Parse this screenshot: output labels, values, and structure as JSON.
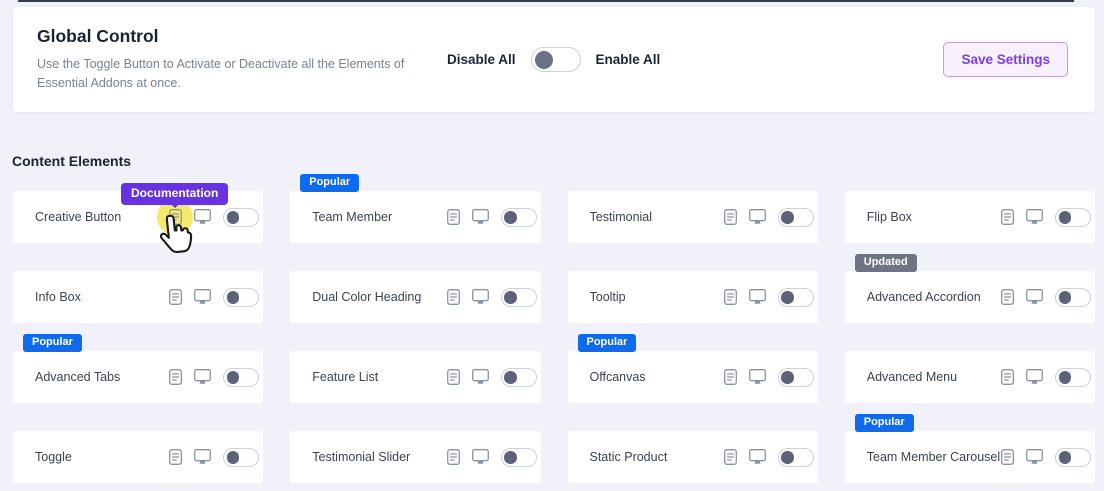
{
  "colors": {
    "page_bg": "#f1f1fa",
    "accent_purple": "#7a3bf0",
    "save_btn_bg": "#f8f0ff",
    "save_btn_border": "#c09bf0",
    "badge_popular": "#0e6bf0",
    "badge_updated": "#6d7585",
    "tooltip_bg": "#6732e3",
    "toggle_knob": "#5c6378",
    "highlight_yellow": "#f3e549",
    "heading_text": "#1b2232",
    "card_text": "#3d4352"
  },
  "global_control": {
    "title": "Global Control",
    "description": "Use the Toggle Button to Activate or Deactivate all the Elements of Essential Addons at once.",
    "disable_all_label": "Disable All",
    "enable_all_label": "Enable All",
    "save_button_label": "Save Settings",
    "master_toggle_state": "off"
  },
  "content_elements": {
    "section_title": "Content Elements",
    "tooltip_label": "Documentation",
    "items": [
      {
        "name": "Creative Button",
        "badge": "",
        "toggle": "off",
        "highlighted": true
      },
      {
        "name": "Team Member",
        "badge": "Popular",
        "toggle": "off"
      },
      {
        "name": "Testimonial",
        "badge": "",
        "toggle": "off"
      },
      {
        "name": "Flip Box",
        "badge": "",
        "toggle": "off"
      },
      {
        "name": "Info Box",
        "badge": "",
        "toggle": "off"
      },
      {
        "name": "Dual Color Heading",
        "badge": "",
        "toggle": "off"
      },
      {
        "name": "Tooltip",
        "badge": "",
        "toggle": "off"
      },
      {
        "name": "Advanced Accordion",
        "badge": "Updated",
        "toggle": "off"
      },
      {
        "name": "Advanced Tabs",
        "badge": "Popular",
        "toggle": "off"
      },
      {
        "name": "Feature List",
        "badge": "",
        "toggle": "off"
      },
      {
        "name": "Offcanvas",
        "badge": "Popular",
        "toggle": "off"
      },
      {
        "name": "Advanced Menu",
        "badge": "",
        "toggle": "off"
      },
      {
        "name": "Toggle",
        "badge": "",
        "toggle": "off"
      },
      {
        "name": "Testimonial Slider",
        "badge": "",
        "toggle": "off"
      },
      {
        "name": "Static Product",
        "badge": "",
        "toggle": "off"
      },
      {
        "name": "Team Member Carousel",
        "badge": "Popular",
        "toggle": "off"
      }
    ]
  }
}
